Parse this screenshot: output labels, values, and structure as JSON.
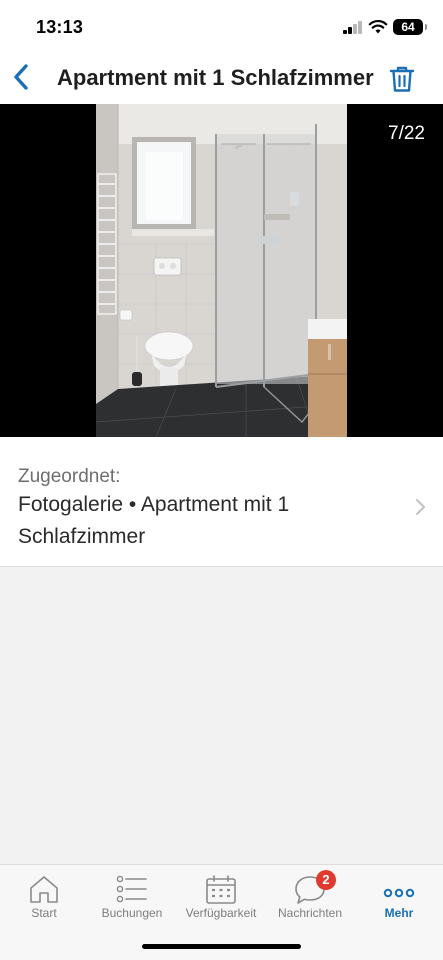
{
  "status_bar": {
    "time": "13:13",
    "battery": "64"
  },
  "header": {
    "title": "Apartment mit 1 Schlafzimmer",
    "back_icon": "chevron-left-icon",
    "trash_icon": "trash-icon",
    "accent_color": "#1b6fb5"
  },
  "viewer": {
    "counter": "7/22"
  },
  "assigned": {
    "label": "Zugeordnet:",
    "value": "Fotogalerie • Apartment mit 1 Schlafzimmer"
  },
  "tabs": [
    {
      "label": "Start",
      "icon": "home-icon",
      "active": false
    },
    {
      "label": "Buchungen",
      "icon": "list-icon",
      "active": false
    },
    {
      "label": "Verfügbarkeit",
      "icon": "calendar-icon",
      "active": false
    },
    {
      "label": "Nachrichten",
      "icon": "chat-bubble-icon",
      "active": false,
      "badge": "2"
    },
    {
      "label": "Mehr",
      "icon": "more-dots-icon",
      "active": true
    }
  ]
}
